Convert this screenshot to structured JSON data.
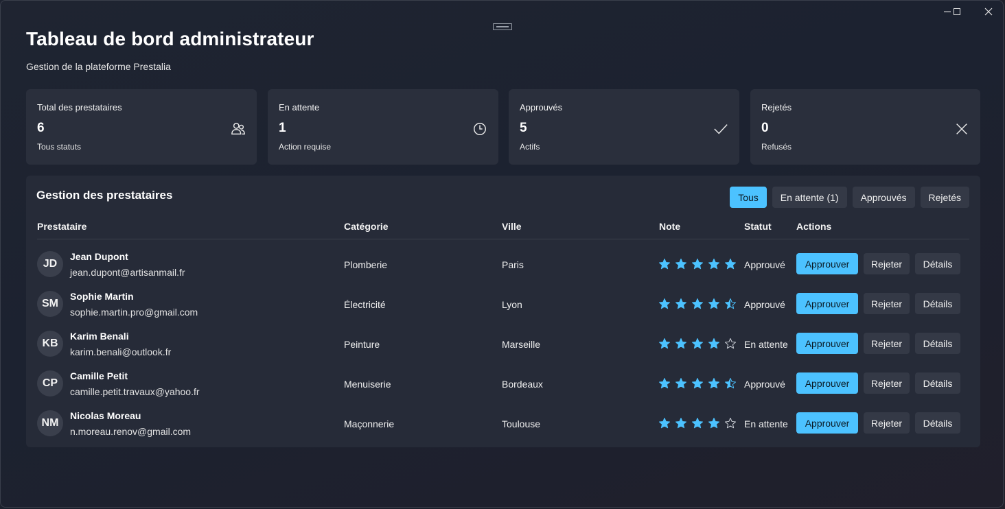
{
  "window": {
    "title": "Tableau de bord administrateur",
    "subtitle": "Gestion de la plateforme Prestalia"
  },
  "stats": [
    {
      "label": "Total des prestataires",
      "value": "6",
      "note": "Tous statuts",
      "icon": "users-icon"
    },
    {
      "label": "En attente",
      "value": "1",
      "note": "Action requise",
      "icon": "clock-icon"
    },
    {
      "label": "Approuvés",
      "value": "5",
      "note": "Actifs",
      "icon": "check-icon"
    },
    {
      "label": "Rejetés",
      "value": "0",
      "note": "Refusés",
      "icon": "close-icon"
    }
  ],
  "panel": {
    "title": "Gestion des prestataires",
    "filters": [
      "Tous",
      "En attente (1)",
      "Approuvés",
      "Rejetés"
    ],
    "active_filter": "Tous",
    "columns": [
      "Prestataire",
      "Catégorie",
      "Ville",
      "Note",
      "Statut",
      "Actions"
    ],
    "actions": {
      "approve": "Approuver",
      "reject": "Rejeter",
      "details": "Détails"
    },
    "rows": [
      {
        "initials": "JD",
        "name": "Jean Dupont",
        "email": "jean.dupont@artisanmail.fr",
        "category": "Plomberie",
        "city": "Paris",
        "rating": 5,
        "status": "Approuvé"
      },
      {
        "initials": "SM",
        "name": "Sophie Martin",
        "email": "sophie.martin.pro@gmail.com",
        "category": "Électricité",
        "city": "Lyon",
        "rating": 4.5,
        "status": "Approuvé"
      },
      {
        "initials": "KB",
        "name": "Karim Benali",
        "email": "karim.benali@outlook.fr",
        "category": "Peinture",
        "city": "Marseille",
        "rating": 4,
        "status": "En attente"
      },
      {
        "initials": "CP",
        "name": "Camille Petit",
        "email": "camille.petit.travaux@yahoo.fr",
        "category": "Menuiserie",
        "city": "Bordeaux",
        "rating": 4.5,
        "status": "Approuvé"
      },
      {
        "initials": "NM",
        "name": "Nicolas Moreau",
        "email": "n.moreau.renov@gmail.com",
        "category": "Maçonnerie",
        "city": "Toulouse",
        "rating": 4,
        "status": "En attente"
      }
    ]
  },
  "colors": {
    "accent": "#4cc2ff",
    "star": "#4cc2ff",
    "card": "#2a2f3c",
    "panel": "#262b38"
  }
}
